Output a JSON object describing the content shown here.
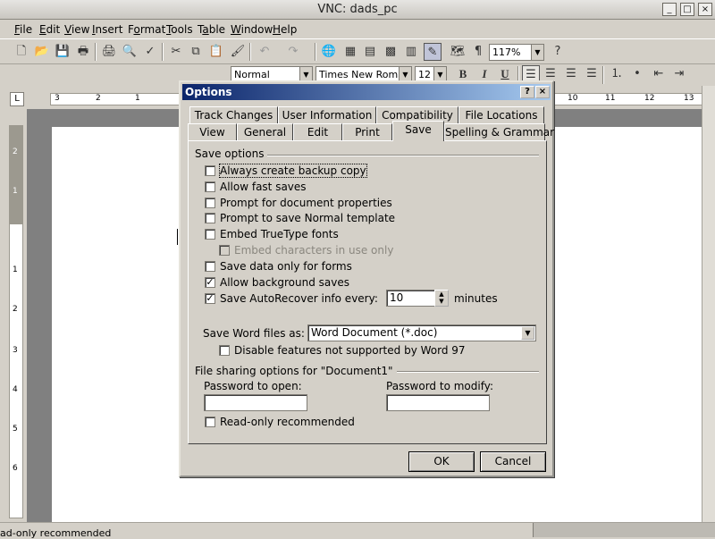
{
  "window": {
    "title": "VNC: dads_pc",
    "controls": {
      "minimize": "_",
      "maximize": "□",
      "close": "×"
    }
  },
  "menubar": {
    "items": [
      "File",
      "Edit",
      "View",
      "Insert",
      "Format",
      "Tools",
      "Table",
      "Window",
      "Help"
    ],
    "mnemonics": [
      "F",
      "E",
      "V",
      "I",
      "o",
      "T",
      "a",
      "W",
      "H"
    ]
  },
  "toolbar": {
    "zoom": "117%",
    "style": "Normal",
    "font": "Times New Roman",
    "size": "12",
    "bold": "B",
    "italic": "I",
    "underline": "U",
    "icons": [
      "new-icon",
      "open-icon",
      "save-icon",
      "permission-icon",
      "print-icon",
      "print-preview-icon",
      "spelling-icon",
      "cut-icon",
      "copy-icon",
      "paste-icon",
      "format-painter-icon",
      "undo-icon",
      "redo-icon",
      "hyperlink-icon",
      "tables-borders-icon",
      "insert-table-icon",
      "insert-excel-icon",
      "columns-icon",
      "drawing-icon",
      "document-map-icon",
      "show-hide-icon",
      "help-icon"
    ]
  },
  "ruler": {
    "horizontal_left": [
      "3",
      "2",
      "1"
    ],
    "horizontal_right": [
      "10",
      "11",
      "12",
      "13"
    ],
    "vertical": [
      "2",
      "1",
      "1",
      "2",
      "3",
      "4",
      "5",
      "6"
    ]
  },
  "status": {
    "text": "ad-only recommended"
  },
  "dialog": {
    "title": "Options",
    "help": "?",
    "close": "×",
    "tabs_row1": [
      "Track Changes",
      "User Information",
      "Compatibility",
      "File Locations"
    ],
    "tabs_row2": [
      "View",
      "General",
      "Edit",
      "Print",
      "Save",
      "Spelling & Grammar"
    ],
    "active_tab": "Save",
    "save_options_label": "Save options",
    "options": [
      {
        "label": "Always create backup copy",
        "checked": false,
        "disabled": false
      },
      {
        "label": "Allow fast saves",
        "checked": false,
        "disabled": false
      },
      {
        "label": "Prompt for document properties",
        "checked": false,
        "disabled": false
      },
      {
        "label": "Prompt to save Normal template",
        "checked": false,
        "disabled": false
      },
      {
        "label": "Embed TrueType fonts",
        "checked": false,
        "disabled": false
      },
      {
        "label": "Embed characters in use only",
        "checked": false,
        "disabled": true
      },
      {
        "label": "Save data only for forms",
        "checked": false,
        "disabled": false
      },
      {
        "label": "Allow background saves",
        "checked": true,
        "disabled": false
      },
      {
        "label": "Save AutoRecover info every:",
        "checked": true,
        "disabled": false
      }
    ],
    "autorecover_minutes": "10",
    "minutes_label": "minutes",
    "save_as_label": "Save Word files as:",
    "save_as_value": "Word Document (*.doc)",
    "disable_features_label": "Disable features not supported by Word 97",
    "disable_features_checked": false,
    "file_sharing_label": "File sharing options for \"Document1\"",
    "password_open_label": "Password to open:",
    "password_open_value": "",
    "password_modify_label": "Password to modify:",
    "password_modify_value": "",
    "readonly_label": "Read-only recommended",
    "readonly_checked": false,
    "ok_label": "OK",
    "cancel_label": "Cancel"
  }
}
